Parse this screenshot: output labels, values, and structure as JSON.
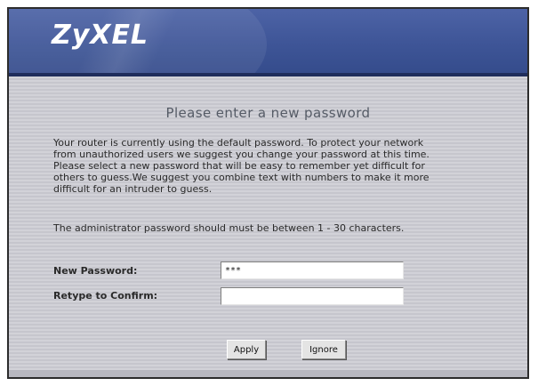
{
  "header": {
    "logo_text": "ZyXEL"
  },
  "main": {
    "title": "Please enter a new password",
    "intro_lines": [
      "Your router is currently using the default password. To protect your network",
      "from unauthorized users we suggest you change your password at this time.",
      "Please select a new password that will be easy to remember yet difficult for",
      "others to guess.We suggest you combine text with numbers to make it more",
      "difficult for an intruder to guess."
    ],
    "rule_text": "The administrator password should must be between 1 - 30 characters.",
    "fields": {
      "new_password_label": "New Password:",
      "new_password_value": "***",
      "confirm_label": "Retype to Confirm:",
      "confirm_value": ""
    },
    "buttons": {
      "apply_label": "Apply",
      "ignore_label": "Ignore"
    }
  },
  "colors": {
    "header_blue": "#3e5597",
    "header_dark": "#1f2d5c",
    "content_bg": "#cbcbd3",
    "title_text": "#555b66"
  }
}
